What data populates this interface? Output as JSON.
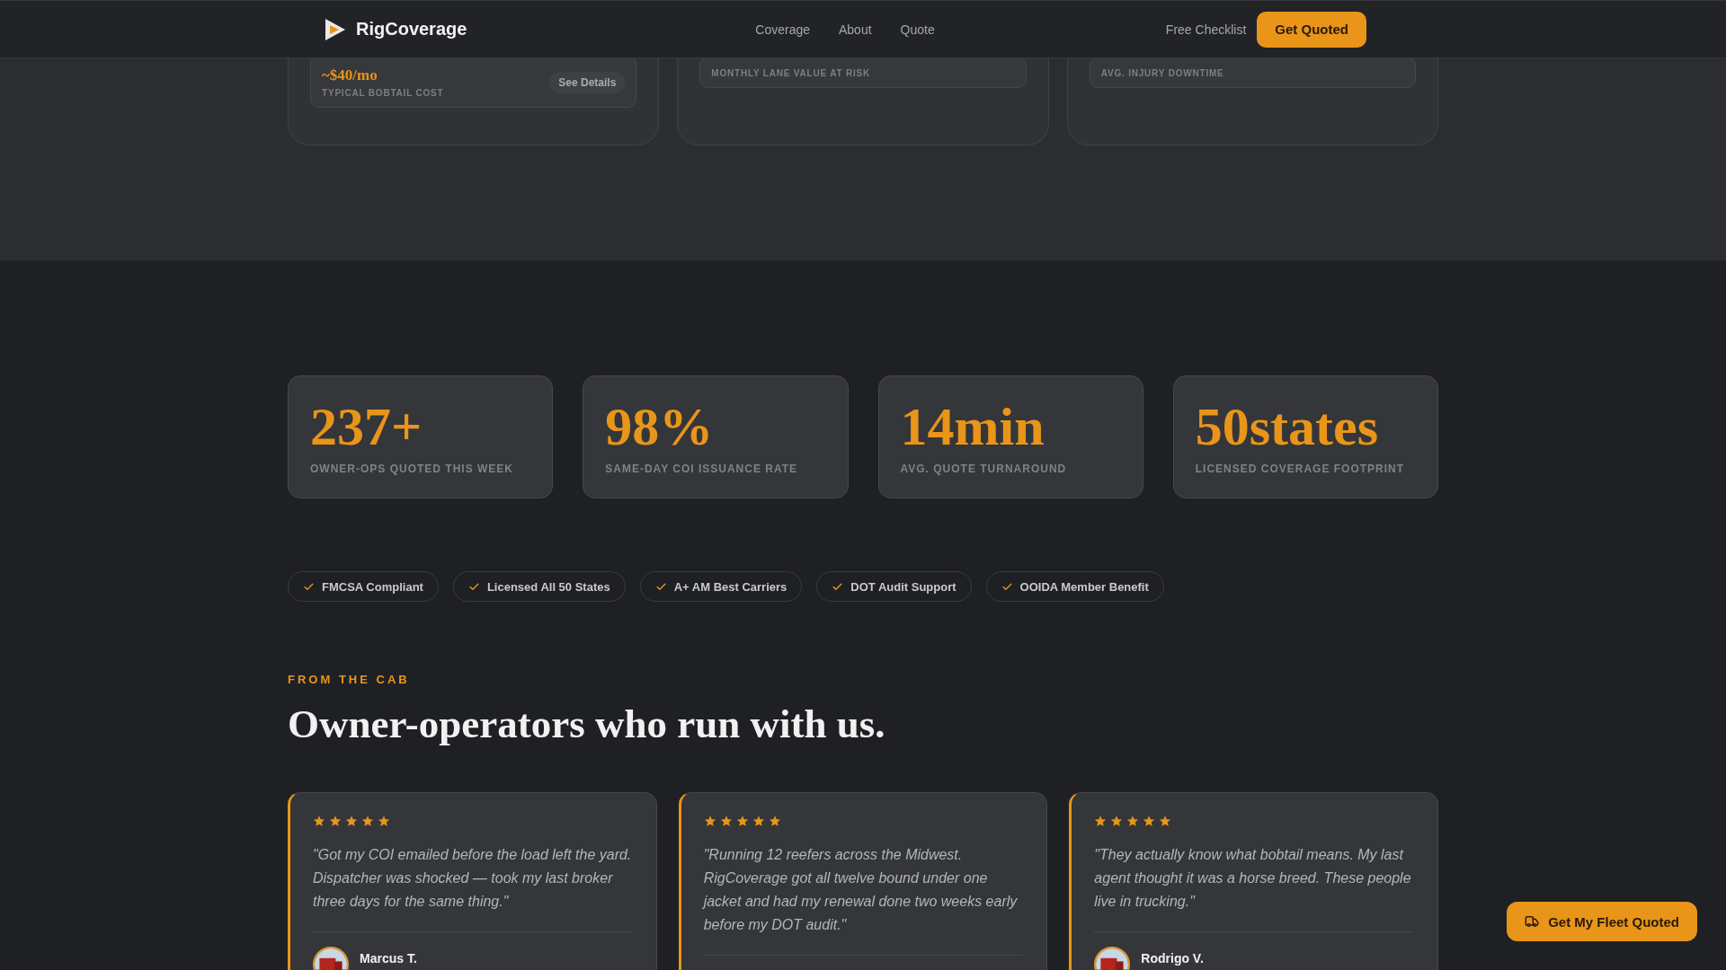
{
  "header": {
    "brand": "RigCoverage",
    "nav": [
      "Coverage",
      "About",
      "Quote"
    ],
    "link": "Free Checklist",
    "cta": "Get Quoted"
  },
  "top_cards": [
    {
      "value": "~$40/mo",
      "label": "TYPICAL BOBTAIL COST",
      "button": "See Details"
    },
    {
      "label": "MONTHLY LANE VALUE AT RISK"
    },
    {
      "label": "AVG. INJURY DOWNTIME"
    }
  ],
  "stats": [
    {
      "value": "237+",
      "label": "OWNER-OPS QUOTED THIS WEEK"
    },
    {
      "value": "98%",
      "label": "SAME-DAY COI ISSUANCE RATE"
    },
    {
      "value": "14min",
      "label": "AVG. QUOTE TURNAROUND"
    },
    {
      "value": "50states",
      "label": "LICENSED COVERAGE FOOTPRINT"
    }
  ],
  "badges": [
    "FMCSA Compliant",
    "Licensed All 50 States",
    "A+ AM Best Carriers",
    "DOT Audit Support",
    "OOIDA Member Benefit"
  ],
  "testimonials_section": {
    "eyebrow": "FROM THE CAB",
    "heading": "Owner-operators who run with us."
  },
  "testimonials": [
    {
      "stars": 5,
      "quote": "\"Got my COI emailed before the load left the yard. Dispatcher was shocked — took my last broker three days for the same thing.\"",
      "author": "Marcus T."
    },
    {
      "stars": 5,
      "quote": "\"Running 12 reefers across the Midwest. RigCoverage got all twelve bound under one jacket and had my renewal done two weeks early before my DOT audit.\""
    },
    {
      "stars": 5,
      "quote": "\"They actually know what bobtail means. My last agent thought it was a horse breed. These people live in trucking.\"",
      "author": "Rodrigo V."
    }
  ],
  "floating_button": "Get My Fleet Quoted"
}
